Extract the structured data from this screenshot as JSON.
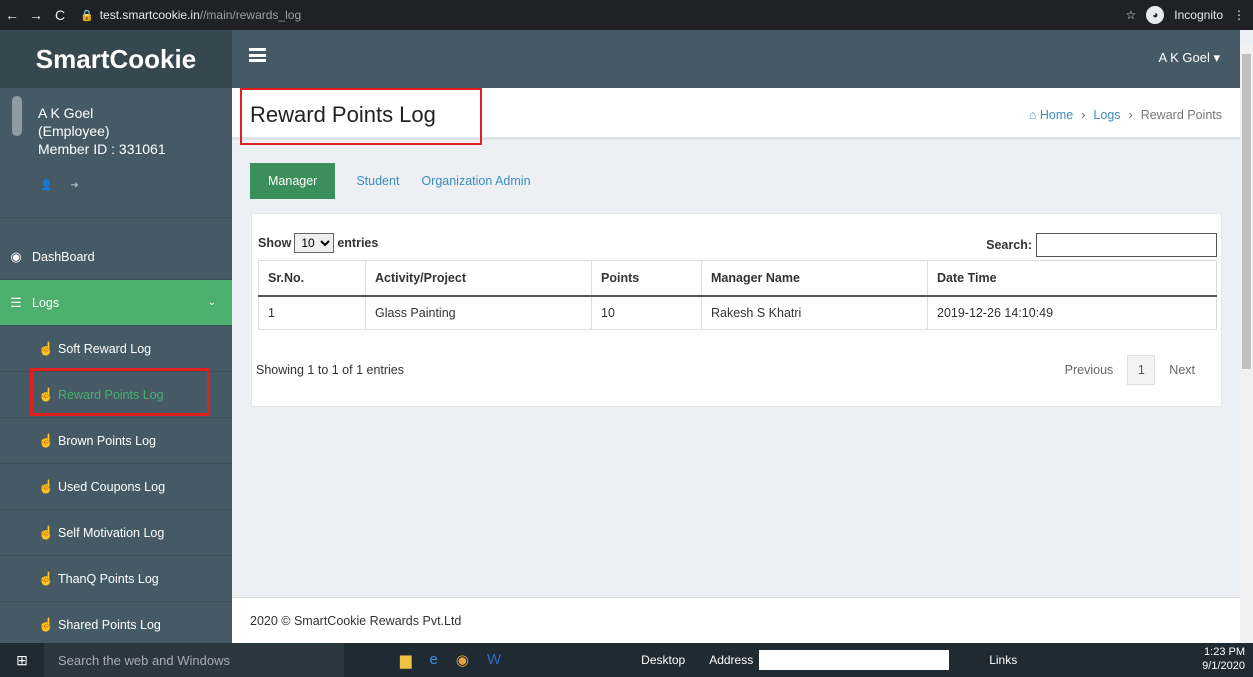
{
  "browser": {
    "url_host": "test.smartcookie.in",
    "url_path": "//main/rewards_log",
    "incognito_label": "Incognito"
  },
  "brand": "SmartCookie",
  "user_menu": "A K Goel ▾",
  "user": {
    "name": "A K Goel",
    "role": "(Employee)",
    "member_id": "Member ID : 331061"
  },
  "sidebar": {
    "dashboard": "DashBoard",
    "logs": "Logs",
    "sub_items": [
      "Soft Reward Log",
      "Reward Points Log",
      "Brown Points Log",
      "Used Coupons Log",
      "Self Motivation Log",
      "ThanQ Points Log",
      "Shared Points Log"
    ]
  },
  "page": {
    "title": "Reward Points Log",
    "breadcrumb": {
      "home": "Home",
      "logs": "Logs",
      "current": "Reward Points"
    }
  },
  "tabs": [
    "Manager",
    "Student",
    "Organization Admin"
  ],
  "table_controls": {
    "show": "Show",
    "entries": "entries",
    "page_length": "10",
    "search_label": "Search:"
  },
  "table": {
    "headers": [
      "Sr.No.",
      "Activity/Project",
      "Points",
      "Manager Name",
      "Date Time"
    ],
    "rows": [
      [
        "1",
        "Glass Painting",
        "10",
        "Rakesh S Khatri",
        "2019-12-26 14:10:49"
      ]
    ]
  },
  "pagination": {
    "info": "Showing 1 to 1 of 1 entries",
    "previous": "Previous",
    "current": "1",
    "next": "Next"
  },
  "footer": "2020 © SmartCookie Rewards Pvt.Ltd",
  "taskbar": {
    "search": "Search the web and Windows",
    "desktop": "Desktop",
    "address": "Address",
    "links": "Links",
    "time": "1:23 PM",
    "date": "9/1/2020"
  },
  "colors": {
    "sidebar": "#455a64",
    "brand_bg": "#37474f",
    "active_green": "#4caf6e",
    "tab_green": "#3a8f5b",
    "link": "#3c8dbc",
    "highlight_red": "#e02020"
  }
}
